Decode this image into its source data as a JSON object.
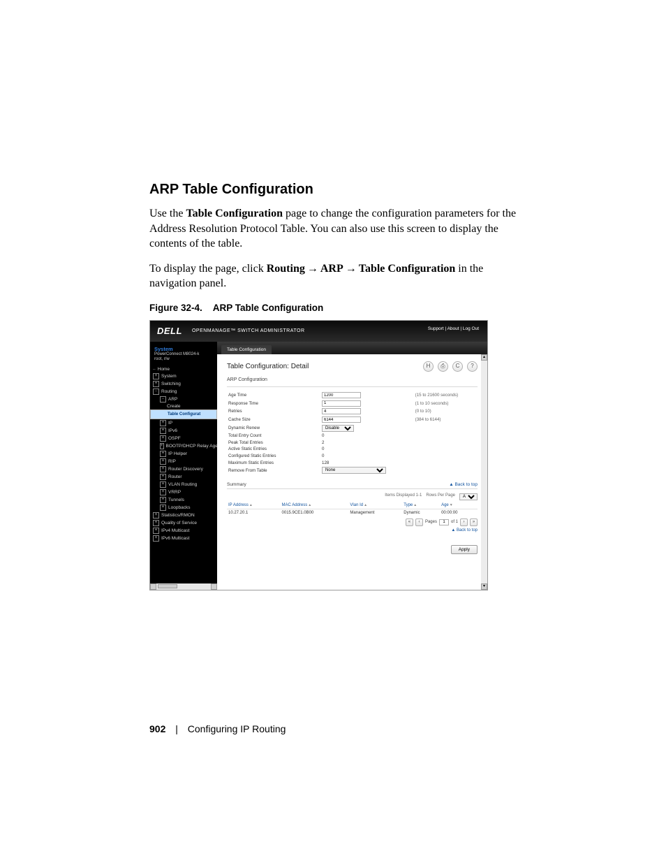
{
  "doc": {
    "heading": "ARP Table Configuration",
    "para1_a": "Use the ",
    "para1_b": "Table Configuration",
    "para1_c": " page to change the configuration parameters for the Address Resolution Protocol Table. You can also use this screen to display the contents of the table.",
    "para2_a": "To display the page, click ",
    "para2_b": "Routing",
    "para2_c": "ARP",
    "para2_d": "Table Configuration",
    "para2_e": " in the navigation panel.",
    "fig_label": "Figure 32-4.",
    "fig_title": "ARP Table Configuration",
    "page_number": "902",
    "chapter": "Configuring IP Routing"
  },
  "shot": {
    "brand": "DELL",
    "product": "OPENMANAGE™ SWITCH ADMINISTRATOR",
    "toplinks": "Support  |  About  |  Log Out",
    "side": {
      "system": "System",
      "device": "PowerConnect M8024-k",
      "user": "root, r/w",
      "items": [
        {
          "t": "Home",
          "pm": "",
          "cls": "ind0 dash"
        },
        {
          "t": "System",
          "pm": "+",
          "cls": ""
        },
        {
          "t": "Switching",
          "pm": "+",
          "cls": ""
        },
        {
          "t": "Routing",
          "pm": "-",
          "cls": ""
        },
        {
          "t": "ARP",
          "pm": "-",
          "cls": "ind1"
        },
        {
          "t": "Create",
          "pm": "",
          "cls": "ind2"
        },
        {
          "t": "Table Configurat",
          "pm": "",
          "cls": "ind2 sel"
        },
        {
          "t": "IP",
          "pm": "+",
          "cls": "ind1"
        },
        {
          "t": "IPv6",
          "pm": "+",
          "cls": "ind1"
        },
        {
          "t": "OSPF",
          "pm": "+",
          "cls": "ind1"
        },
        {
          "t": "BOOTP/DHCP Relay Age",
          "pm": "+",
          "cls": "ind1"
        },
        {
          "t": "IP Helper",
          "pm": "+",
          "cls": "ind1"
        },
        {
          "t": "RIP",
          "pm": "+",
          "cls": "ind1"
        },
        {
          "t": "Router Discovery",
          "pm": "+",
          "cls": "ind1"
        },
        {
          "t": "Router",
          "pm": "+",
          "cls": "ind1"
        },
        {
          "t": "VLAN Routing",
          "pm": "+",
          "cls": "ind1"
        },
        {
          "t": "VRRP",
          "pm": "+",
          "cls": "ind1"
        },
        {
          "t": "Tunnels",
          "pm": "+",
          "cls": "ind1"
        },
        {
          "t": "Loopbacks",
          "pm": "+",
          "cls": "ind1"
        },
        {
          "t": "Statistics/RMON",
          "pm": "+",
          "cls": ""
        },
        {
          "t": "Quality of Service",
          "pm": "+",
          "cls": ""
        },
        {
          "t": "IPv4 Multicast",
          "pm": "+",
          "cls": ""
        },
        {
          "t": "IPv6 Multicast",
          "pm": "+",
          "cls": ""
        }
      ]
    },
    "tab": "Table Configuration",
    "title": "Table Configuration: Detail",
    "section1": "ARP Configuration",
    "rows": [
      {
        "label": "Age Time",
        "value": "1200",
        "hint": "(15 to 21600 seconds)",
        "type": "input"
      },
      {
        "label": "Response Time",
        "value": "1",
        "hint": "(1 to 10 seconds)",
        "type": "input"
      },
      {
        "label": "Retries",
        "value": "4",
        "hint": "(0 to 10)",
        "type": "input"
      },
      {
        "label": "Cache Size",
        "value": "6144",
        "hint": "(384 to 6144)",
        "type": "input"
      },
      {
        "label": "Dynamic Renew",
        "value": "Disable",
        "hint": "",
        "type": "select"
      },
      {
        "label": "Total Entry Count",
        "value": "0",
        "hint": "",
        "type": "text"
      },
      {
        "label": "Peak Total Entries",
        "value": "2",
        "hint": "",
        "type": "text"
      },
      {
        "label": "Active Static Entries",
        "value": "0",
        "hint": "",
        "type": "text"
      },
      {
        "label": "Configured Static Entries",
        "value": "0",
        "hint": "",
        "type": "text"
      },
      {
        "label": "Maximum Static Entries",
        "value": "128",
        "hint": "",
        "type": "text"
      },
      {
        "label": "Remove From Table",
        "value": "None",
        "hint": "",
        "type": "select-wide"
      }
    ],
    "summary_label": "Summary",
    "back_to_top": "Back to top",
    "items_displayed": "Items Displayed 1-1",
    "rows_per_page": "Rows Per Page",
    "rows_per_page_val": "All",
    "cols": [
      "IP Address",
      "MAC Address",
      "Vlan Id",
      "Type",
      "Age"
    ],
    "data_row": {
      "ip": "10.27.20.1",
      "mac": "0015.9CE1.0B00",
      "vlan": "Management",
      "type": "Dynamic",
      "age": "00:00:00"
    },
    "pages_label": "Pages",
    "pages_val": "1",
    "pages_of": "of 1",
    "apply": "Apply"
  }
}
